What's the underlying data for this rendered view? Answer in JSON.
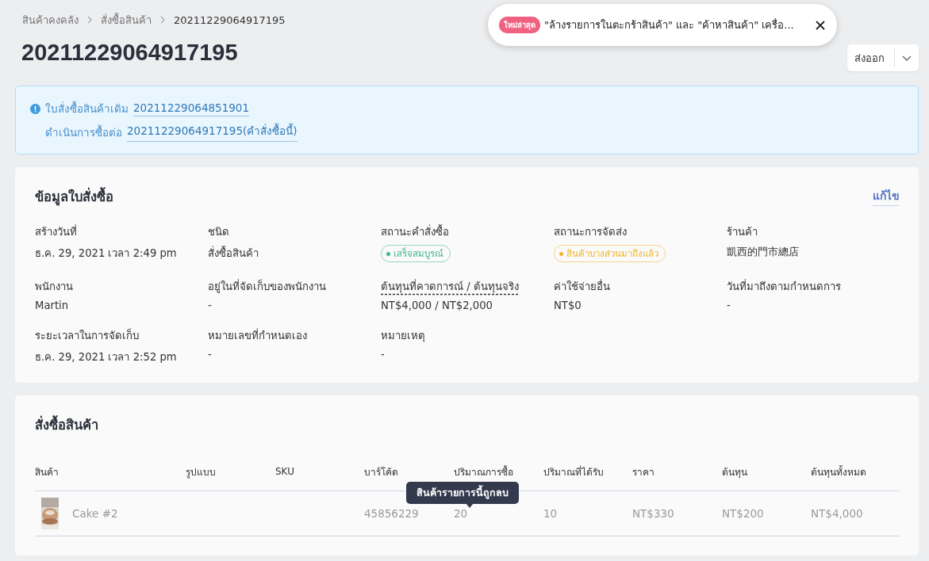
{
  "breadcrumbs": [
    {
      "label": "สินค้าคงคลัง"
    },
    {
      "label": "สั่งซื้อสินค้า"
    },
    {
      "label": "20211229064917195"
    }
  ],
  "title": "20211229064917195",
  "toast": {
    "badge": "ใหม่ล่าสุด",
    "text": "\"ล้างรายการในตะกร้าสินค้า\" และ \"ค้าหาสินค้า\" เครื่อ..."
  },
  "export_button": {
    "label": "ส่งออก"
  },
  "notice": {
    "lines": [
      {
        "label": "ใบสั่งซื้อสินค้าเดิม",
        "link": "20211229064851901"
      },
      {
        "label": "ดำเนินการซื้อต่อ",
        "link": "20211229064917195(คำสั่งซื้อนี้)"
      }
    ]
  },
  "order_info": {
    "title": "ข้อมูลใบสั่งซื้อ",
    "edit": "แก้ไข",
    "fields": [
      {
        "label": "สร้างวันที่",
        "value": "ธ.ค. 29, 2021 เวลา 2:49 pm"
      },
      {
        "label": "ชนิด",
        "value": "สั่งซื้อสินค้า"
      },
      {
        "label": "สถานะคำสั่งซื้อ",
        "kind": "badge",
        "value": "เสร็จสมบูรณ์",
        "color": "#3fb68b"
      },
      {
        "label": "สถานะการจัดส่ง",
        "kind": "badge",
        "value": "สินค้าบางส่วนมาถึงแล้ว",
        "color": "#f0b429"
      },
      {
        "label": "ร้านค้า",
        "value": "凱西的門市總店"
      },
      {
        "label": "พนักงาน",
        "value": "Martin"
      },
      {
        "label": "อยู่ในที่จัดเก็บของพนักงาน",
        "value": "-"
      },
      {
        "label": "ต้นทุนที่คาดการณ์ / ต้นทุนจริง",
        "hint": true,
        "value": "NT$4,000 / NT$2,000"
      },
      {
        "label": "ค่าใช้จ่ายอื่น",
        "value": "NT$0"
      },
      {
        "label": "วันที่มาถึงตามกำหนดการ",
        "value": "-"
      },
      {
        "label": "ระยะเวลาในการจัดเก็บ",
        "value": "ธ.ค. 29, 2021 เวลา 2:52 pm"
      },
      {
        "label": "หมายเลขที่กำหนดเอง",
        "value": "-"
      },
      {
        "label": "หมายเหตุ",
        "value": "-"
      }
    ]
  },
  "products": {
    "title": "สั่งซื้อสินค้า",
    "columns": [
      "สินค้า",
      "รูปแบบ",
      "SKU",
      "บาร์โค้ด",
      "ปริมาณการซื้อ",
      "ปริมาณที่ได้รับ",
      "ราคา",
      "ต้นทุน",
      "ต้นทุนทั้งหมด"
    ],
    "rows": [
      {
        "deleted": true,
        "cells": [
          "Cake #2",
          "",
          "",
          "45856229",
          "20",
          "10",
          "NT$330",
          "NT$200",
          "NT$4,000"
        ],
        "tooltip": "สินค้ารายการนี้ถูกลบ"
      }
    ]
  }
}
